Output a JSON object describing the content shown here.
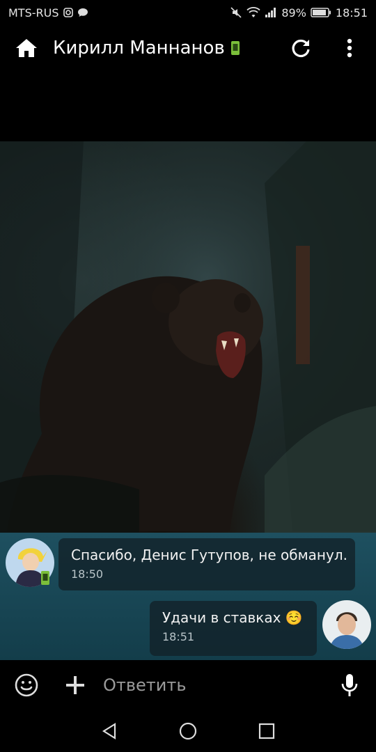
{
  "status": {
    "carrier": "MTS-RUS",
    "battery": "89%",
    "time": "18:51"
  },
  "header": {
    "title": "Кирилл Маннанов"
  },
  "messages": [
    {
      "text": "Спасибо, Денис Гутупов, не обманул.",
      "time": "18:50",
      "direction": "incoming"
    },
    {
      "text": "Удачи в ставках ☺️",
      "time": "18:51",
      "direction": "outgoing"
    }
  ],
  "composer": {
    "placeholder": "Ответить"
  },
  "colors": {
    "chat_bg": "#1e5060",
    "bubble_bg": "#12222a",
    "mobile_badge": "#7bbf3a"
  },
  "icons": [
    "home-icon",
    "mobile-badge-icon",
    "refresh-icon",
    "more-vert-icon",
    "emoji-icon",
    "plus-icon",
    "mic-icon",
    "nav-back-icon",
    "nav-home-icon",
    "nav-recents-icon"
  ]
}
